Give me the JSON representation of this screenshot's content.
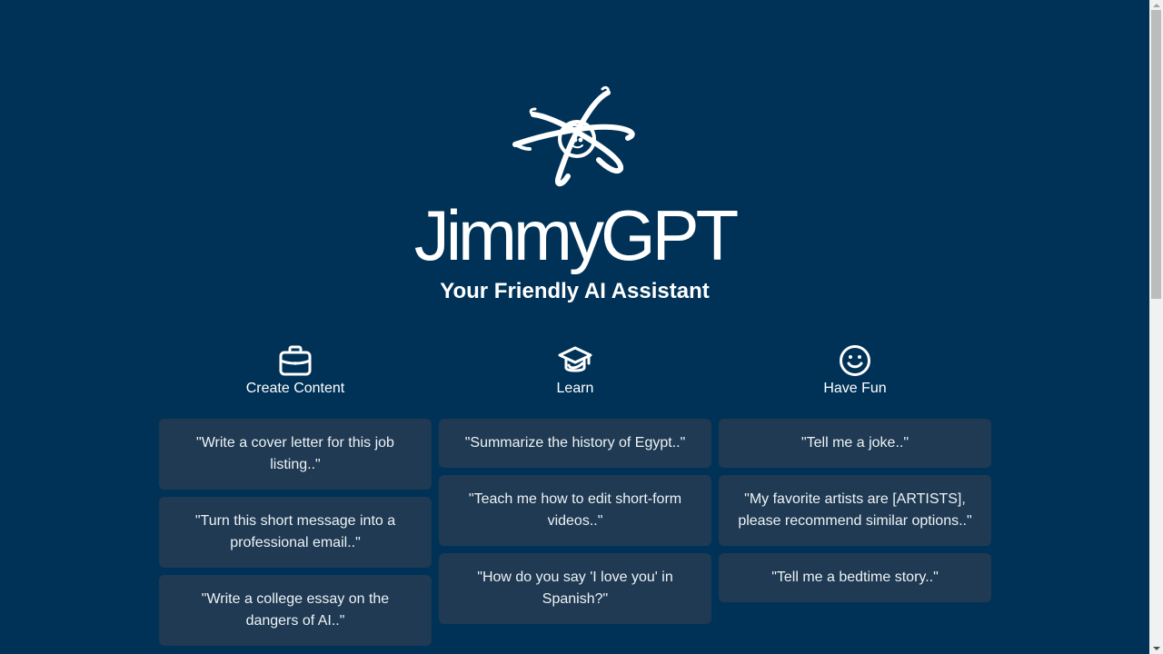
{
  "brand": {
    "logo_icon": "atom-smiley-icon",
    "name": "JimmyGPT",
    "tagline": "Your Friendly AI Assistant"
  },
  "colors": {
    "background": "#003257",
    "card": "#1f3a52",
    "text": "#ffffff"
  },
  "columns": [
    {
      "icon": "briefcase-icon",
      "title": "Create Content",
      "prompts": [
        "\"Write a cover letter for this job listing..\"",
        "\"Turn this short message into a professional email..\"",
        "\"Write a college essay on the dangers of AI..\""
      ]
    },
    {
      "icon": "graduation-cap-icon",
      "title": "Learn",
      "prompts": [
        "\"Summarize the history of Egypt..\"",
        "\"Teach me how to edit short-form videos..\"",
        "\"How do you say 'I love you' in Spanish?\""
      ]
    },
    {
      "icon": "smiley-icon",
      "title": "Have Fun",
      "prompts": [
        "\"Tell me a joke..\"",
        "\"My favorite artists are [ARTISTS], please recommend similar options..\"",
        "\"Tell me a bedtime story..\""
      ]
    }
  ]
}
